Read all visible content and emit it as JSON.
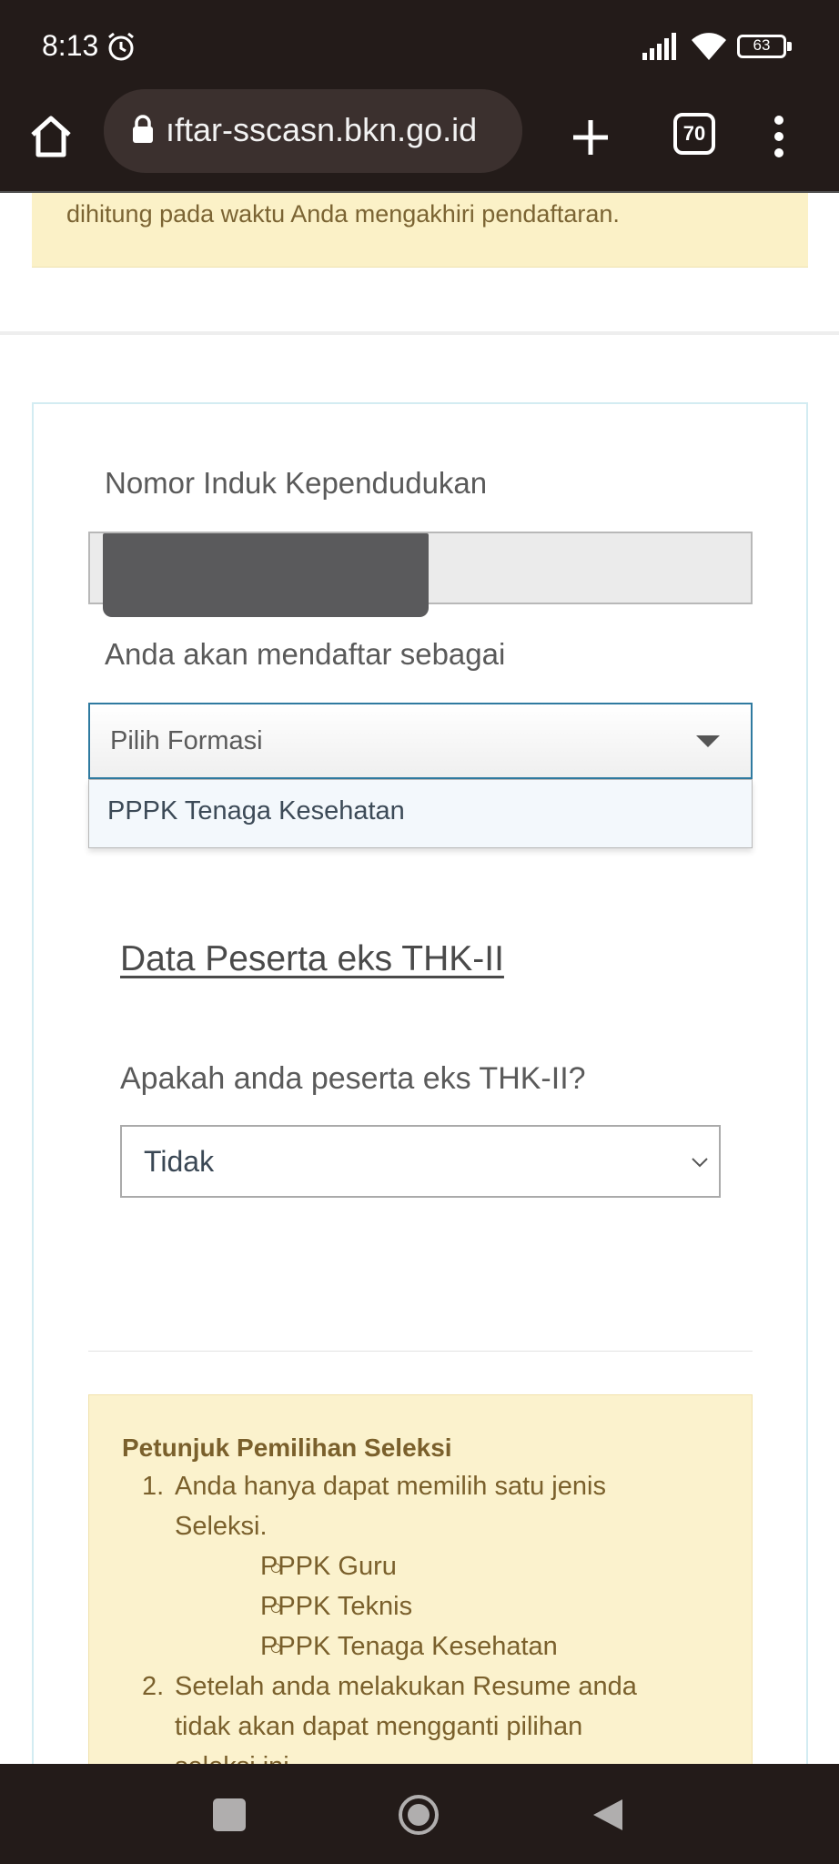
{
  "status_bar": {
    "time": "8:13",
    "battery_level": "63"
  },
  "browser": {
    "url": "ıftar-sscasn.bkn.go.id",
    "tab_count": "70"
  },
  "notice": {
    "text": "dihitung pada waktu Anda mengakhiri pendaftaran."
  },
  "form": {
    "nik_label": "Nomor Induk Kependudukan",
    "nik_value": "",
    "daftar_label": "Anda akan mendaftar sebagai",
    "formasi_placeholder": "Pilih Formasi",
    "formasi_options": [
      "PPPK Tenaga Kesehatan"
    ],
    "thk_heading": "Data Peserta eks THK-II",
    "thk_question": "Apakah anda peserta eks THK-II?",
    "thk_selected": "Tidak"
  },
  "instructions": {
    "title": "Petunjuk Pemilihan Seleksi",
    "item1_num": "1.",
    "item1_line1": "Anda hanya dapat memilih satu jenis",
    "item1_line2": "Seleksi.",
    "sub_items": [
      "PPPK Guru",
      "PPPK Teknis",
      "PPPK Tenaga Kesehatan"
    ],
    "item2_num": "2.",
    "item2_line1": "Setelah anda melakukan Resume anda",
    "item2_line2": "tidak akan dapat mengganti pilihan",
    "item2_line3": "seleksi ini."
  }
}
